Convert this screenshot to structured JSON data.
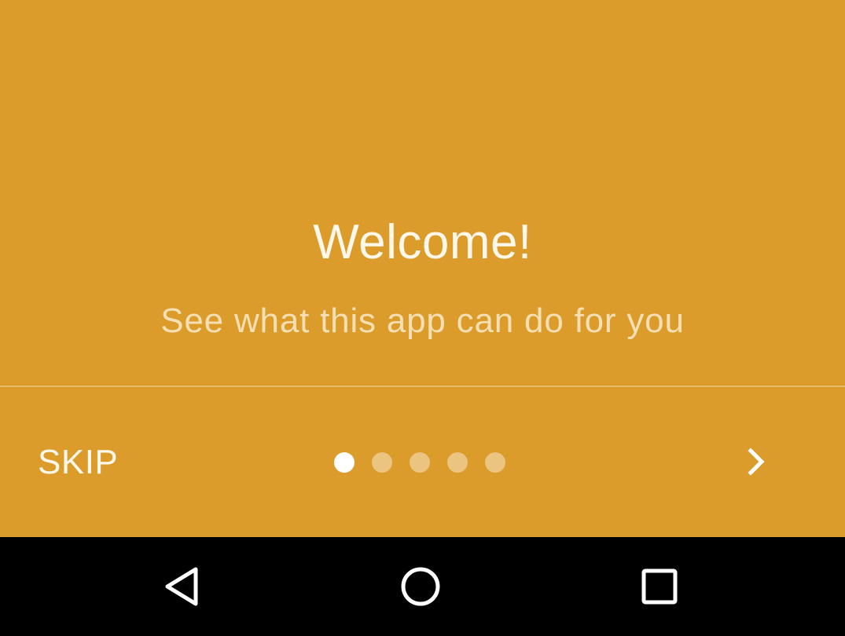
{
  "onboarding": {
    "background_color": "#DB9C2B",
    "title": "Welcome!",
    "subtitle": "See what this app can do for you",
    "skip_label": "SKIP",
    "pager": {
      "total_pages": 5,
      "current_page": 1
    },
    "next_icon": "chevron-right-icon"
  },
  "navigation_bar": {
    "back_icon": "back-triangle-icon",
    "home_icon": "home-circle-icon",
    "recents_icon": "recents-square-icon"
  }
}
